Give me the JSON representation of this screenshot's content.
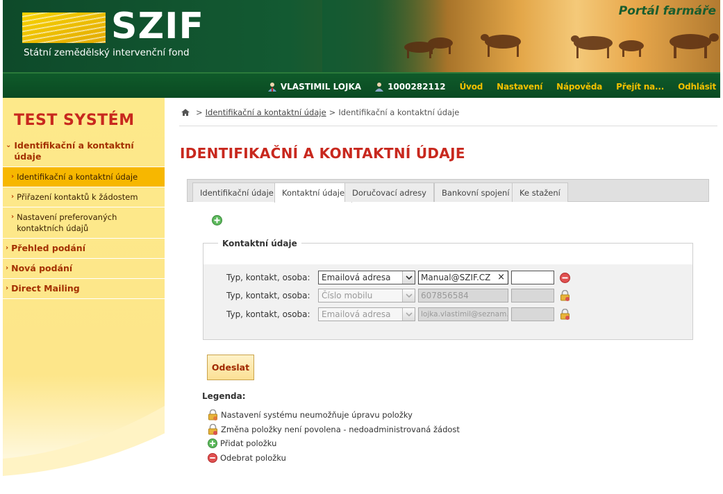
{
  "header": {
    "logo_text": "SZIF",
    "logo_subtitle": "Státní zemědělský intervenční fond",
    "portal_title": "Portál farmáře"
  },
  "nav": {
    "user_name": "VLASTIMIL LOJKA",
    "user_id": "1000282112",
    "links": [
      "Úvod",
      "Nastavení",
      "Nápověda",
      "Přejít na...",
      "Odhlásit"
    ]
  },
  "sidebar": {
    "title": "TEST SYSTÉM",
    "items": [
      {
        "label": "Identifikační a kontaktní údaje",
        "level": 1,
        "expanded": true
      },
      {
        "label": "Identifikační a kontaktní údaje",
        "level": 2,
        "active": true
      },
      {
        "label": "Přiřazení kontaktů k žádostem",
        "level": 2
      },
      {
        "label": "Nastavení preferovaných kontaktních údajů",
        "level": 2
      },
      {
        "label": "Přehled podání",
        "level": 1
      },
      {
        "label": "Nová podání",
        "level": 1
      },
      {
        "label": "Direct Mailing",
        "level": 1
      }
    ]
  },
  "breadcrumb": {
    "link": "Identifikační a kontaktní údaje",
    "current": "Identifikační a kontaktní údaje",
    "separator": ">"
  },
  "page_title": "IDENTIFIKAČNÍ A KONTAKTNÍ ÚDAJE",
  "tabs": [
    "Identifikační údaje",
    "Kontaktní údaje",
    "Doručovací adresy",
    "Bankovní spojení",
    "Ke stažení"
  ],
  "active_tab": "Kontaktní údaje",
  "contact_section": {
    "legend": "Kontaktní údaje",
    "rows": [
      {
        "label": "Typ, kontakt, osoba:",
        "type": "Emailová adresa",
        "value": "Manual@SZIF.CZ",
        "person": "",
        "editable": true,
        "action": "remove"
      },
      {
        "label": "Typ, kontakt, osoba:",
        "type": "Číslo mobilu",
        "value": "607856584",
        "person": "",
        "editable": false,
        "action": "locked"
      },
      {
        "label": "Typ, kontakt, osoba:",
        "type": "Emailová adresa",
        "value": "lojka.vlastimil@seznam.cz",
        "person": "",
        "editable": false,
        "action": "locked"
      }
    ]
  },
  "submit_label": "Odeslat",
  "legend": {
    "title": "Legenda:",
    "items": [
      {
        "icon": "lock-icon",
        "text": "Nastavení systému neumožňuje úpravu položky"
      },
      {
        "icon": "lock-warning-icon",
        "text": "Změna položky není povolena - nedoadministrovaná žádost"
      },
      {
        "icon": "add-icon",
        "text": "Přidat položku"
      },
      {
        "icon": "remove-icon",
        "text": "Odebrat položku"
      }
    ]
  },
  "colors": {
    "brand_green": "#0f5a2a",
    "nav_link": "#f2c000",
    "title_red": "#c8281e",
    "sidebar_bg": "#fde68a",
    "sidebar_active": "#f7b700"
  }
}
